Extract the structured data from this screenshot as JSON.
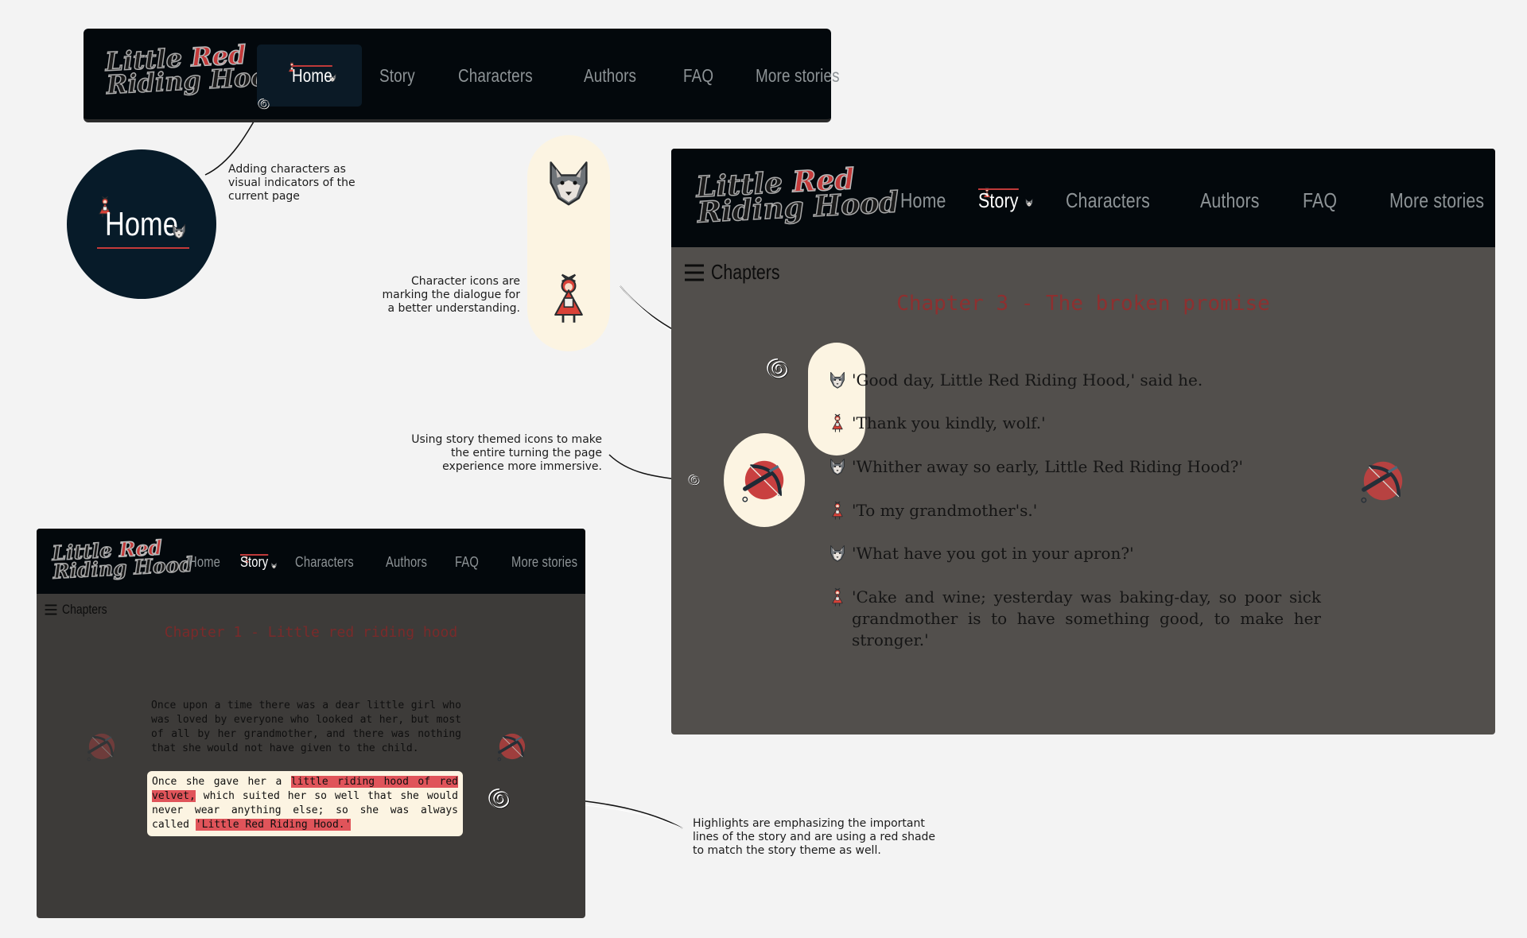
{
  "nav": {
    "logo_line1_a": "Little",
    "logo_line1_b": "Red",
    "logo_line2": "Riding Hood",
    "items": [
      "Home",
      "Story",
      "Characters",
      "Authors",
      "FAQ",
      "More stories"
    ]
  },
  "magnifier": {
    "label": "Home"
  },
  "annotations": {
    "current_page": "Adding characters as\nvisual indicators of the\ncurrent page",
    "character_icons": "Character icons are\nmarking the dialogue for\na better understanding.",
    "themed_icons": "Using story themed icons to make\nthe entire turning the page\nexperience more immersive.",
    "highlights": "Highlights are emphasizing the important\nlines of the story and are using a red shade\nto match the story theme as well."
  },
  "chapter3": {
    "chapters_label": "Chapters",
    "title": "Chapter 3 - The broken promise",
    "lines": [
      {
        "speaker": "wolf",
        "text": "'Good day, Little Red Riding Hood,' said he."
      },
      {
        "speaker": "girl",
        "text": "'Thank you kindly, wolf.'"
      },
      {
        "speaker": "wolf",
        "text": "'Whither away so early, Little Red Riding Hood?'"
      },
      {
        "speaker": "girl",
        "text": "'To my grandmother's.'"
      },
      {
        "speaker": "wolf",
        "text": "'What have you got in your apron?'"
      },
      {
        "speaker": "girl",
        "text": "'Cake and wine; yesterday was baking-day, so poor sick grandmother is to have something good, to make her stronger.'"
      }
    ]
  },
  "chapter1": {
    "chapters_label": "Chapters",
    "title": "Chapter 1 - Little red riding hood",
    "para1": "Once upon a time there was a dear little girl who was loved by everyone who looked at her, but most of all by her grandmother, and there was nothing that she would not have given to the child.",
    "para2_a": "Once she gave her a ",
    "para2_hl1": "little riding hood of red velvet,",
    "para2_b": " which suited her so well that she would never wear anything else; so she was always called ",
    "para2_hl2": "'Little Red Riding Hood.'"
  },
  "colors": {
    "page_bg": "#f3f3f3",
    "nav_bg": "#03080c",
    "nav_active_bg": "#0b1a26",
    "panel_bg": "#524f4c",
    "cream": "#fcf4e2",
    "accent_red": "#c53a3a",
    "highlight_red": "#e0545a"
  },
  "icons": [
    "wolf-icon",
    "red-riding-hood-icon",
    "crossbow-icon",
    "hamburger-menu-icon",
    "scribble-connector-icon"
  ]
}
